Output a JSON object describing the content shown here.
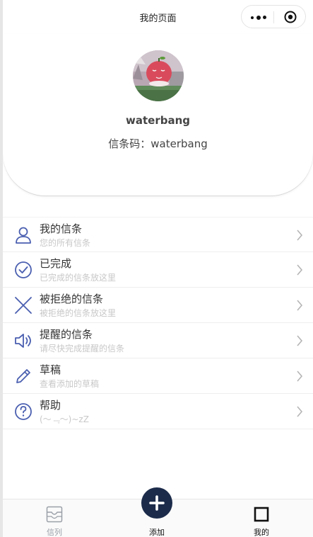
{
  "nav": {
    "title": "我的页面"
  },
  "profile": {
    "username": "waterbang",
    "code_label": "信条码：",
    "code_value": "waterbang"
  },
  "menu": [
    {
      "title": "我的信条",
      "subtitle": "您的所有信条",
      "icon": "user-icon"
    },
    {
      "title": "已完成",
      "subtitle": "已完成的信条放这里",
      "icon": "check-circle-icon"
    },
    {
      "title": "被拒绝的信条",
      "subtitle": "被拒绝的信条放这里",
      "icon": "x-icon"
    },
    {
      "title": "提醒的信条",
      "subtitle": "请尽快完成提醒的信条",
      "icon": "speaker-icon"
    },
    {
      "title": "草稿",
      "subtitle": "查看添加的草稿",
      "icon": "pencil-icon"
    },
    {
      "title": "帮助",
      "subtitle": "(～﹃～)~zZ",
      "icon": "question-circle-icon"
    }
  ],
  "tabbar": {
    "list_label": "信列",
    "add_label": "添加",
    "mine_label": "我的"
  },
  "colors": {
    "accent": "#4a5fb0",
    "add_button": "#1c2b4a",
    "subtitle": "#c8c8c8"
  }
}
